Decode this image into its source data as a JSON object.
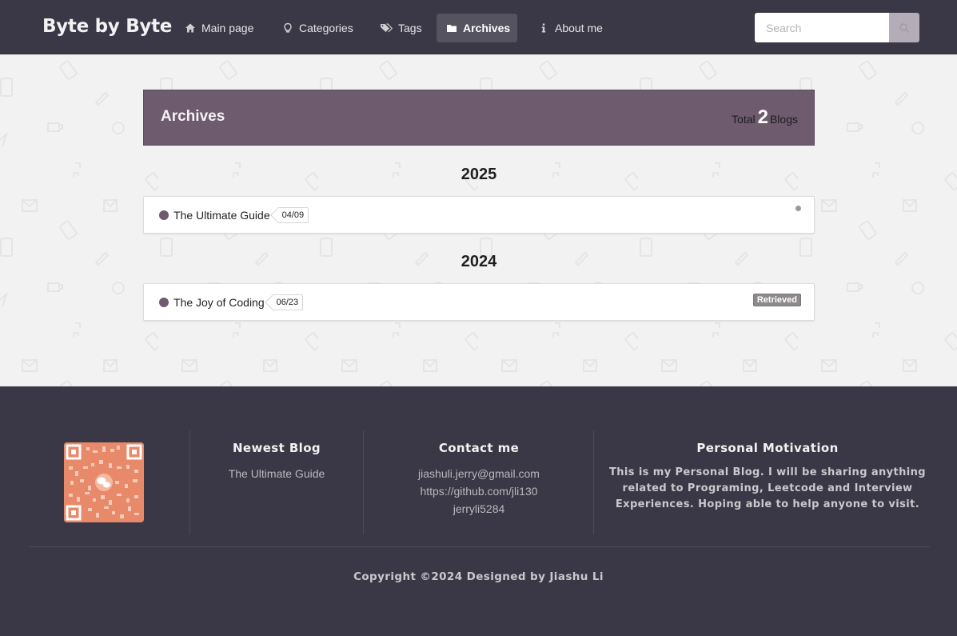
{
  "brand": "Byte by Byte",
  "nav": {
    "items": [
      {
        "label": "Main page",
        "icon": "home-icon"
      },
      {
        "label": "Categories",
        "icon": "lightbulb-icon"
      },
      {
        "label": "Tags",
        "icon": "tags-icon"
      },
      {
        "label": "Archives",
        "icon": "folder-icon",
        "active": true
      },
      {
        "label": "About me",
        "icon": "info-icon"
      }
    ],
    "search_placeholder": "Search"
  },
  "archive": {
    "title": "Archives",
    "total_prefix": "Total",
    "total_count": "2",
    "total_suffix": "Blogs",
    "groups": [
      {
        "year": "2025",
        "posts": [
          {
            "title": "The Ultimate Guide",
            "date": "04/09",
            "badge": ""
          }
        ]
      },
      {
        "year": "2024",
        "posts": [
          {
            "title": "The Joy of Coding",
            "date": "06/23",
            "badge": "Retrieved"
          }
        ]
      }
    ]
  },
  "footer": {
    "newest": {
      "heading": "Newest Blog",
      "items": [
        "The Ultimate Guide"
      ]
    },
    "contact": {
      "heading": "Contact me",
      "items": [
        "jiashuli.jerry@gmail.com",
        "https://github.com/jli130",
        "jerryli5284"
      ]
    },
    "motivation": {
      "heading": "Personal Motivation",
      "lines": [
        "This is my Personal Blog. I will be sharing anything",
        "related to Programing, Leetcode and Interview",
        "Experiences. Hoping able to help anyone to visit."
      ]
    },
    "copyright": "Copyright ©2024 Designed by Jiashu Li"
  },
  "colors": {
    "navbar": "#3a3847",
    "accent": "#6e5b6e",
    "footer": "#3a3847",
    "qr": "#e8896a"
  }
}
